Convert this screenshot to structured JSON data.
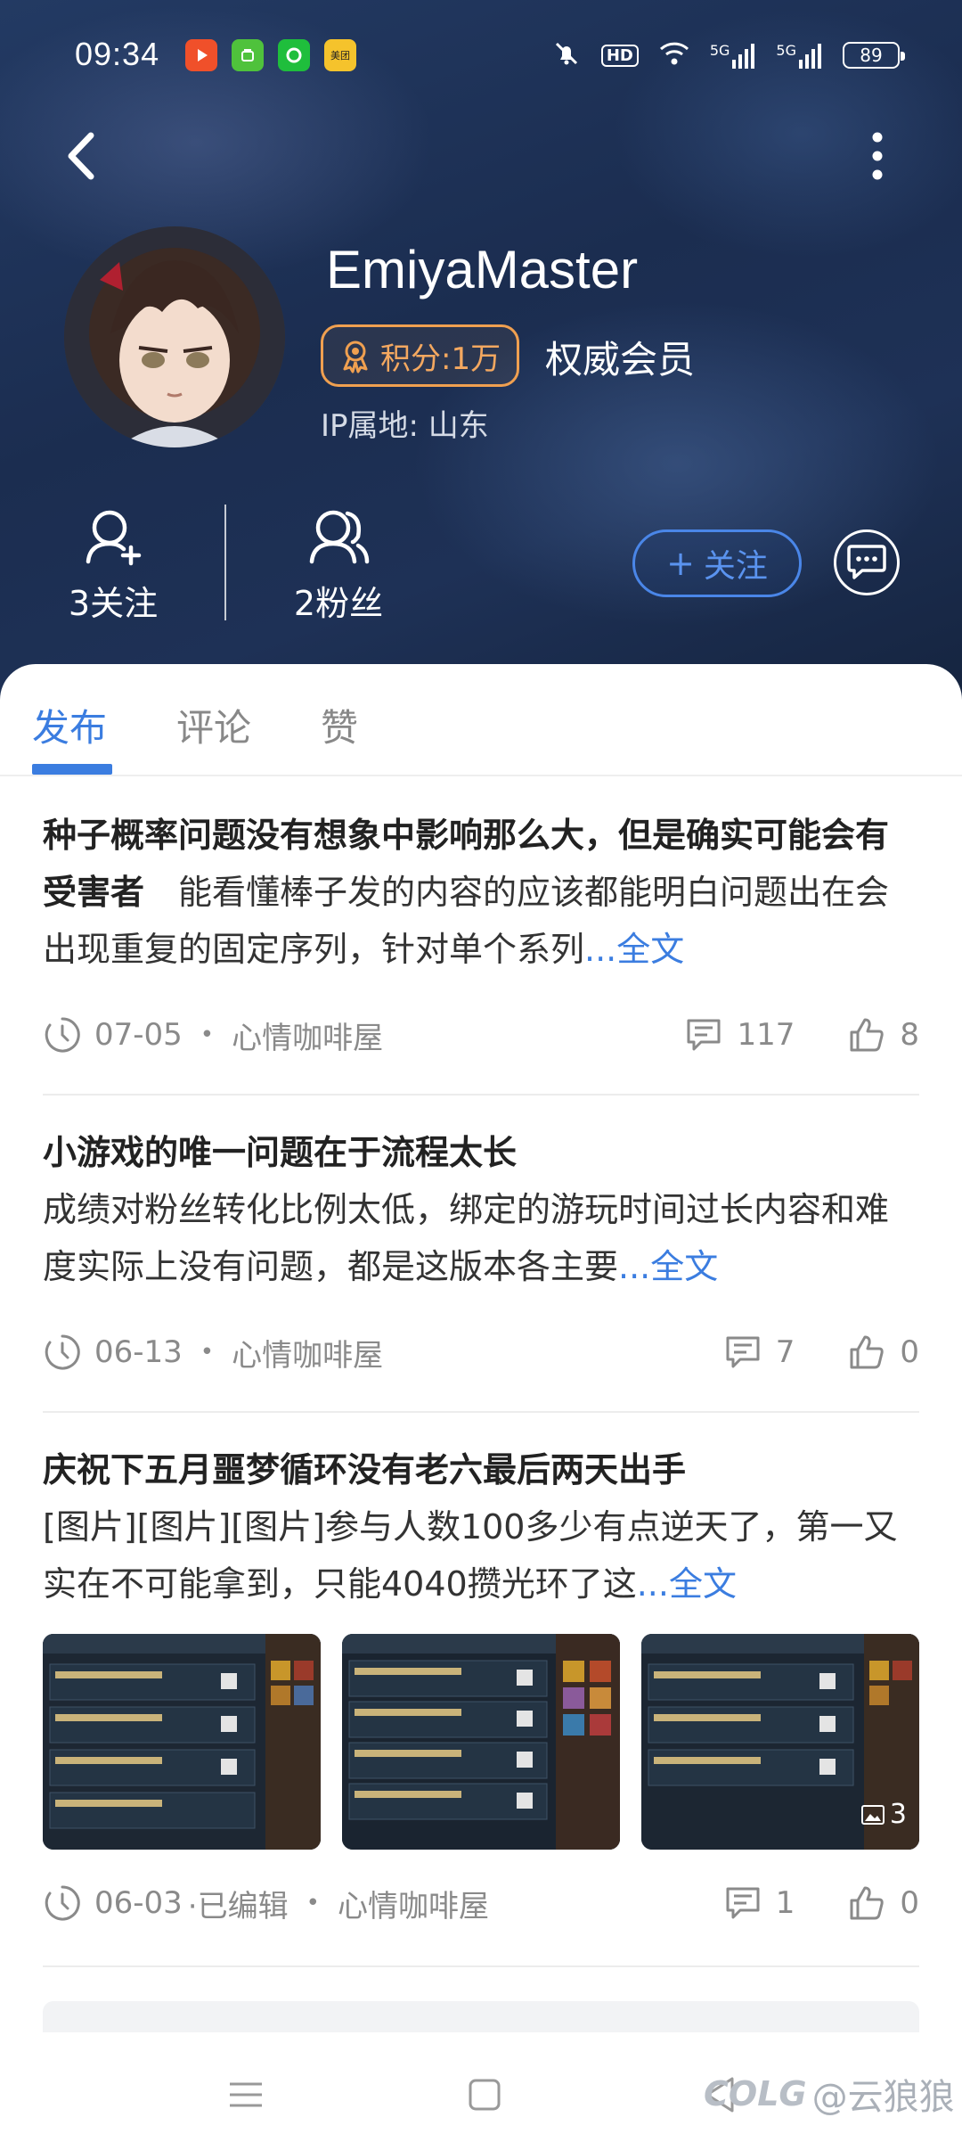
{
  "status_bar": {
    "time": "09:34",
    "apps": [
      "video-app-icon",
      "store-app-icon",
      "chat-app-icon",
      "meituan-app-icon"
    ],
    "meituan_label": "美团",
    "hd_label": "HD",
    "net1": "5G",
    "net2": "5G",
    "battery": "89"
  },
  "profile": {
    "username": "EmiyaMaster",
    "score_label": "积分:1万",
    "member_tag": "权威会员",
    "ip_location": "IP属地: 山东",
    "following_label": "3关注",
    "followers_label": "2粉丝",
    "follow_button": "关注",
    "follow_plus": "+"
  },
  "tabs": [
    {
      "label": "发布",
      "active": true
    },
    {
      "label": "评论",
      "active": false
    },
    {
      "label": "赞",
      "active": false
    }
  ],
  "posts": [
    {
      "title": "种子概率问题没有想象中影响那么大，但是确实可能会有受害者",
      "body": "　能看懂棒子发的内容的应该都能明白问题出在会出现重复的固定序列，针对单个系列",
      "more": "...全文",
      "date": "07-05",
      "edited": "",
      "board": "心情咖啡屋",
      "comments": "117",
      "likes": "8"
    },
    {
      "title": "小游戏的唯一问题在于流程太长",
      "body": "成绩对粉丝转化比例太低，绑定的游玩时间过长内容和难度实际上没有问题，都是这版本各主要",
      "more": "...全文",
      "date": "06-13",
      "edited": "",
      "board": "心情咖啡屋",
      "comments": "7",
      "likes": "0"
    },
    {
      "title": "庆祝下五月噩梦循环没有老六最后两天出手",
      "body": " [图片][图片][图片]参与人数100多少有点逆天了，第一又实在不可能拿到，只能4040攒光环了这",
      "more": "...全文",
      "date": "06-03",
      "edited": "·已编辑",
      "board": "心情咖啡屋",
      "comments": "1",
      "likes": "0",
      "image_count": "3"
    }
  ],
  "watermark": {
    "logo": "COLG",
    "text": "@云狼狼"
  },
  "colors": {
    "accent": "#3b7de0",
    "score_orange": "#f0a050",
    "header_bg": "#1b2d50"
  }
}
